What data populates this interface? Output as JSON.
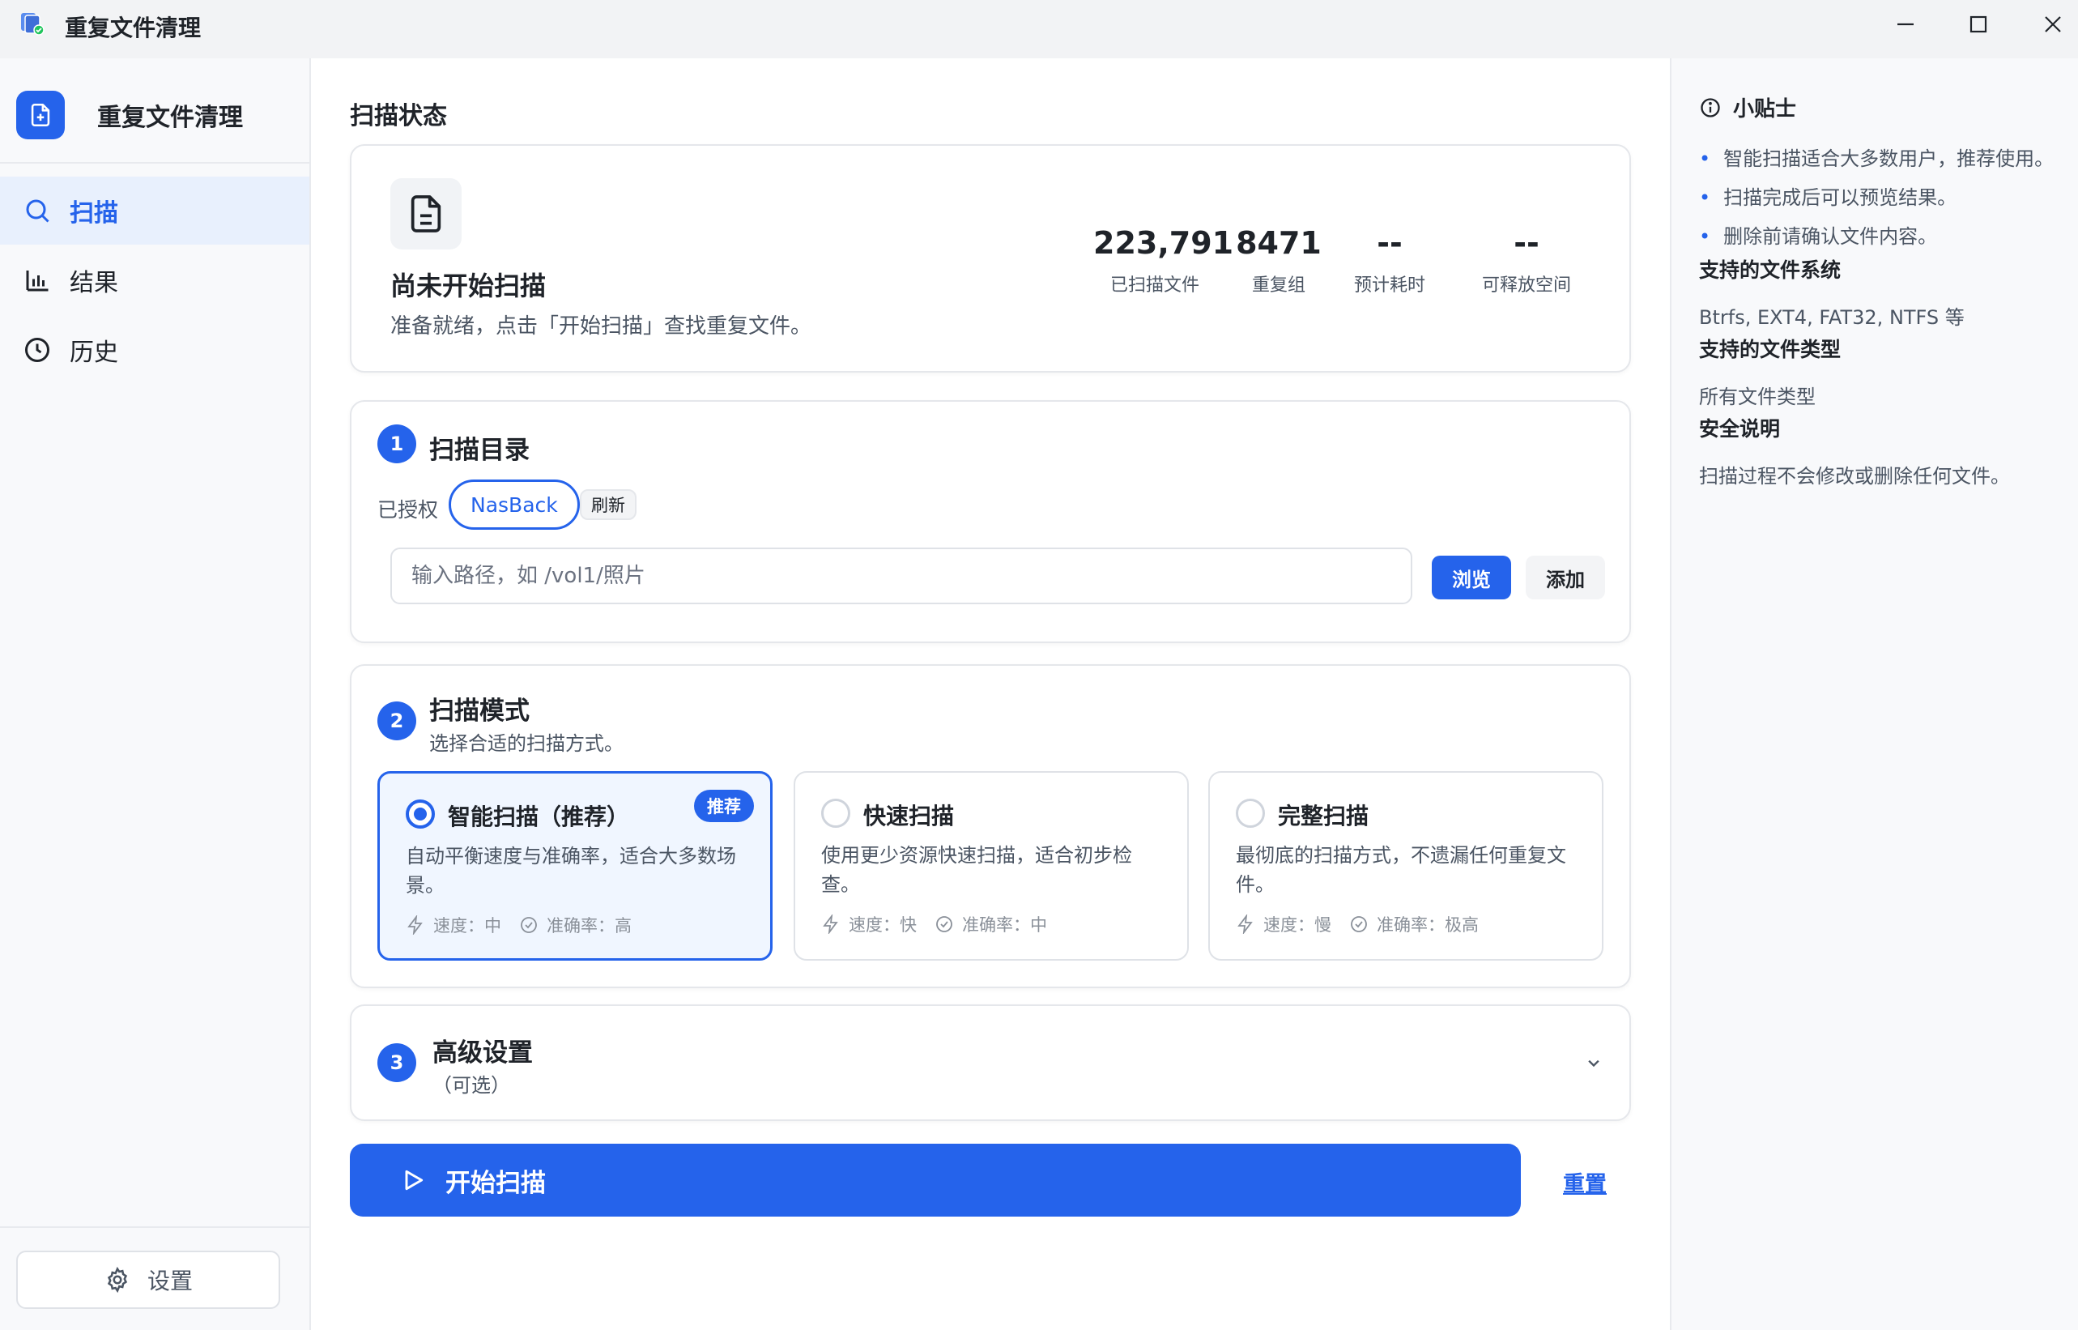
{
  "window": {
    "title": "重复文件清理"
  },
  "sidebar": {
    "brand": "重复文件清理",
    "items": [
      {
        "label": "扫描",
        "icon": "search-icon",
        "active": true
      },
      {
        "label": "结果",
        "icon": "bar-chart-icon",
        "active": false
      },
      {
        "label": "历史",
        "icon": "clock-icon",
        "active": false
      }
    ],
    "settings_label": "设置"
  },
  "status": {
    "section_title": "扫描状态",
    "title": "尚未开始扫描",
    "description": "准备就绪，点击「开始扫描」查找重复文件。",
    "stats": [
      {
        "value": "223,791",
        "label": "已扫描文件"
      },
      {
        "value": "8471",
        "label": "重复组"
      },
      {
        "value": "--",
        "label": "预计耗时"
      },
      {
        "value": "--",
        "label": "可释放空间"
      }
    ]
  },
  "directory": {
    "step": "1",
    "title": "扫描目录",
    "authorized_label": "已授权",
    "chip": "NasBack",
    "refresh_label": "刷新",
    "path_placeholder": "输入路径，如 /vol1/照片",
    "path_value": "",
    "browse_label": "浏览",
    "add_label": "添加"
  },
  "mode": {
    "step": "2",
    "title": "扫描模式",
    "subtitle": "选择合适的扫描方式。",
    "options": [
      {
        "name": "智能扫描（推荐）",
        "badge": "推荐",
        "desc": "自动平衡速度与准确率，适合大多数场景。",
        "speed": "速度：中",
        "accuracy": "准确率：高",
        "selected": true
      },
      {
        "name": "快速扫描",
        "desc": "使用更少资源快速扫描，适合初步检查。",
        "speed": "速度：快",
        "accuracy": "准确率：中",
        "selected": false
      },
      {
        "name": "完整扫描",
        "desc": "最彻底的扫描方式，不遗漏任何重复文件。",
        "speed": "速度：慢",
        "accuracy": "准确率：极高",
        "selected": false
      }
    ]
  },
  "advanced": {
    "step": "3",
    "title": "高级设置",
    "subtitle": "（可选）"
  },
  "actions": {
    "start_label": "开始扫描",
    "reset_label": "重置"
  },
  "tips": {
    "title": "小贴士",
    "bullets": [
      "智能扫描适合大多数用户，推荐使用。",
      "扫描完成后可以预览结果。",
      "删除前请确认文件内容。"
    ],
    "fs_title": "支持的文件系统",
    "fs_text": "Btrfs, EXT4, FAT32, NTFS 等",
    "types_title": "支持的文件类型",
    "types_text": "所有文件类型",
    "safety_title": "安全说明",
    "safety_text": "扫描过程不会修改或删除任何文件。"
  },
  "colors": {
    "accent": "#2563eb",
    "accent_light": "#e8f0fd",
    "text": "#1f2329",
    "muted": "#4b5563"
  }
}
